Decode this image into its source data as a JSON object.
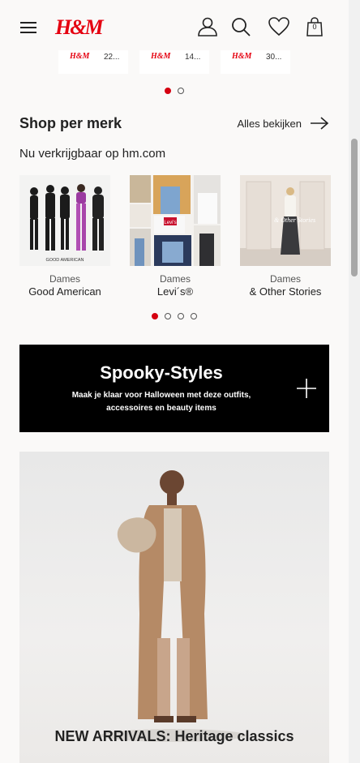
{
  "header": {
    "logo": "H&M",
    "bag_count": "0"
  },
  "mini_carousel": [
    {
      "logo": "H&M",
      "price": "22..."
    },
    {
      "logo": "H&M",
      "price": "14..."
    },
    {
      "logo": "H&M",
      "price": "30..."
    }
  ],
  "shop_by_brand": {
    "title": "Shop per merk",
    "see_all": "Alles bekijken",
    "subtitle": "Nu verkrijgbaar op hm.com",
    "brands": [
      {
        "category": "Dames",
        "name": "Good American",
        "image_text": "GOOD AMERICAN"
      },
      {
        "category": "Dames",
        "name": "Levi´s®",
        "image_text": "Levi's"
      },
      {
        "category": "Dames",
        "name": "& Other Stories",
        "image_text": "& Other Stories"
      }
    ]
  },
  "spooky": {
    "title": "Spooky-Styles",
    "subtitle": "Maak je klaar voor Halloween met deze outfits, accessoires en beauty items"
  },
  "hero": {
    "title": "NEW ARRIVALS: Heritage classics"
  },
  "colors": {
    "brand_red": "#e50010",
    "background": "#faf9f8",
    "banner": "#000000"
  }
}
